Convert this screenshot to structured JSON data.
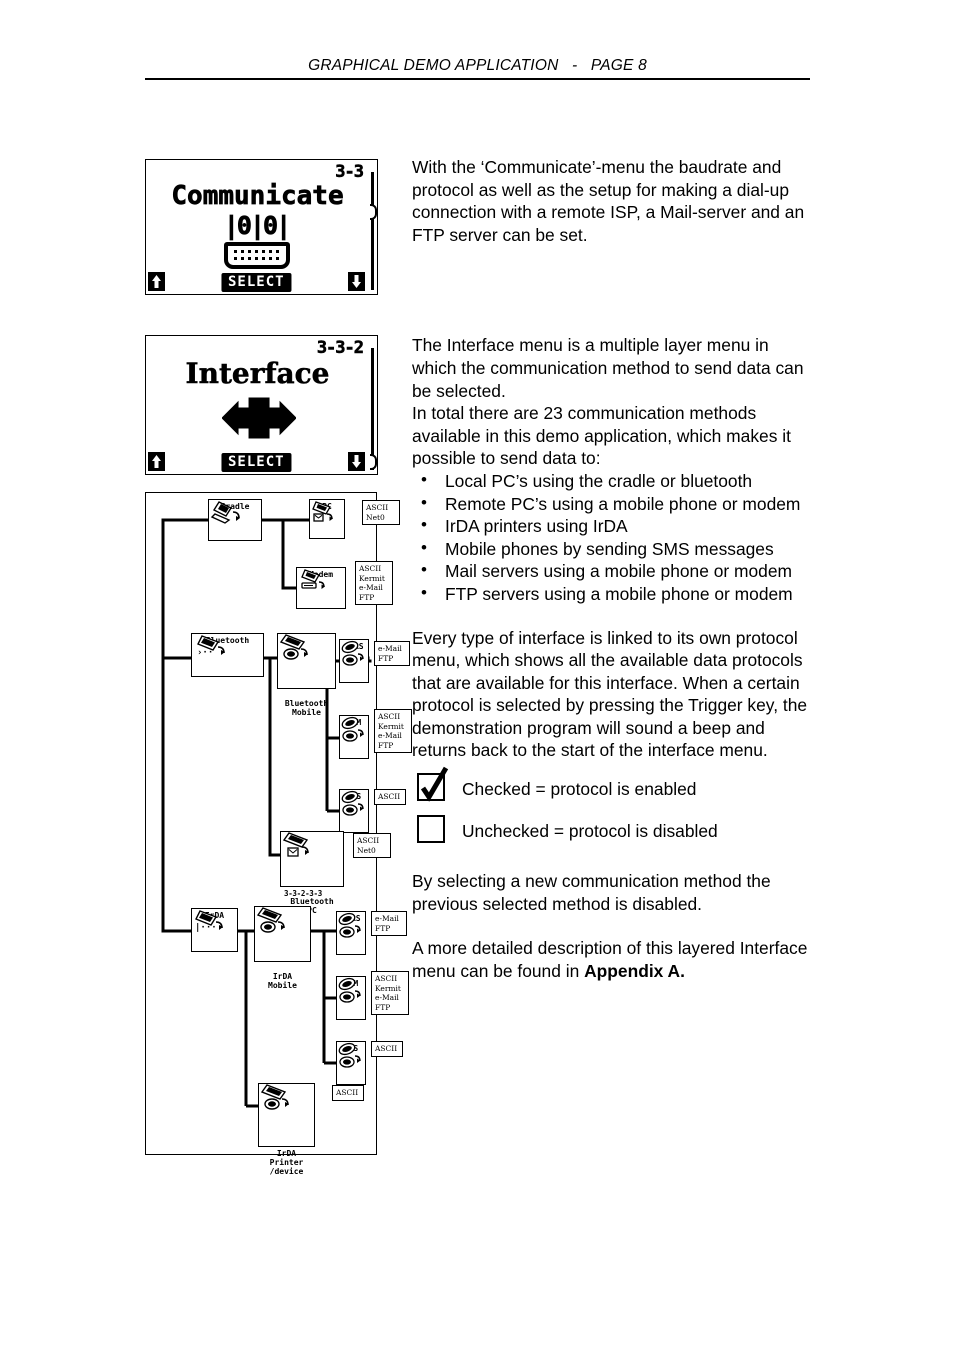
{
  "header": {
    "title": "GRAPHICAL DEMO APPLICATION   -   PAGE 8"
  },
  "screens": [
    {
      "name": "communicate",
      "menu_code": "3-3",
      "title": "Communicate",
      "icon": "serial-connector-icon",
      "bits": "|0|0|",
      "select_label": "SELECT",
      "up_arrow": "arrow-up-icon",
      "down_arrow": "arrow-down-icon"
    },
    {
      "name": "interface",
      "menu_code": "3-3-2",
      "title": "Interface",
      "icon": "double-arrow-icon",
      "select_label": "SELECT",
      "up_arrow": "arrow-up-icon",
      "down_arrow": "arrow-down-icon"
    }
  ],
  "tree": {
    "nodes": {
      "cradle": "Cradle",
      "pc": "PC",
      "modem": "Modem",
      "bluetooth": "Bluetooth",
      "bluetooth_mobile": "Bluetooth\nMobile",
      "bt_gprs": "GPRS",
      "bt_gsm": "GSM",
      "bt_sms": "SMS",
      "bluetooth_pc": "Bluetooth\nPC",
      "irda": "IrDA",
      "irda_mobile": "IrDA\nMobile",
      "ir_gprs": "GPRS",
      "ir_gsm": "GSM",
      "ir_sms": "SMS",
      "irda_printer": "IrDA\nPrinter\n/device"
    },
    "protocols": {
      "pc": "ASCII\nNet0",
      "modem": "ASCII\nKermit\ne-Mail\nFTP",
      "bt_gprs": "e-Mail\nFTP",
      "bt_gsm": "ASCII\nKermit\ne-Mail\nFTP",
      "bt_sms": "ASCII",
      "bluetooth_pc": "ASCII\nNet0",
      "ir_gprs": "e-Mail\nFTP",
      "ir_gsm": "ASCII\nKermit\ne-Mail\nFTP",
      "ir_sms": "ASCII",
      "irda_printer": "ASCII"
    },
    "menu_code_bluetooth_pc": "3-3-2-3-3"
  },
  "text": {
    "para1": "With the ‘Communicate’-menu the baudrate and protocol as well as the setup for making a dial-up connection with a remote ISP, a Mail-server and an FTP server can be set.",
    "para2": "The Interface menu is a multiple layer menu in which the communication method to send data can be selected.",
    "para3": "In total there are 23 communication methods available in this demo application, which makes it possible to send data to:",
    "bullets": [
      "Local PC’s using the cradle or bluetooth",
      "Remote PC’s using a mobile phone or modem",
      "IrDA printers using IrDA",
      "Mobile phones by sending SMS messages",
      "Mail servers using a mobile phone or modem",
      "FTP servers using a mobile phone or modem"
    ],
    "para4": "Every type of interface is linked to its own protocol menu, which shows all the available data protocols that are available for this interface. When a certain protocol is selected by pressing the Trigger key, the demonstration program will sound a beep and returns back to the start of the interface menu.",
    "legend_checked": "Checked = protocol is enabled",
    "legend_unchecked": "Unchecked = protocol is disabled",
    "para5": "By selecting a new communication method the previous selected method is disabled.",
    "para6_prefix": "A more detailed description of this layered Interface menu can be found in ",
    "para6_bold": "Appendix A."
  },
  "colors": {
    "ink": "#000000",
    "page": "#ffffff"
  }
}
